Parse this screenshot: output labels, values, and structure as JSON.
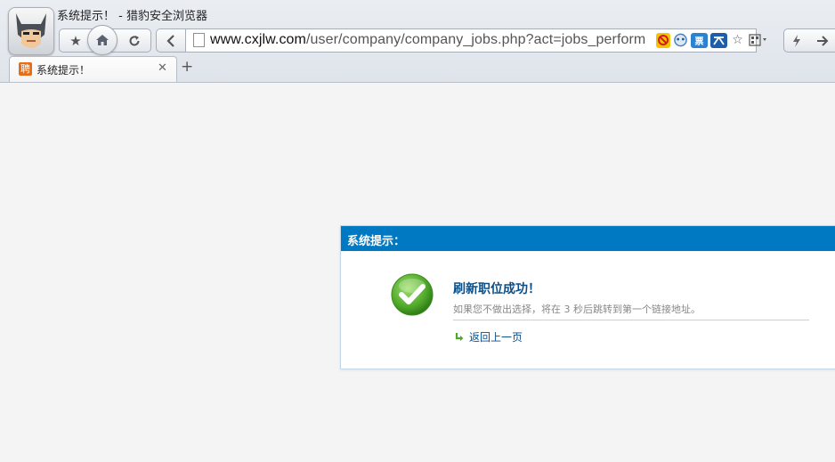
{
  "window": {
    "title": "系统提示！ - 猎豹安全浏览器"
  },
  "toolbar": {
    "bookmark_icon": "star-icon",
    "home_icon": "home-icon",
    "refresh_icon": "refresh-icon",
    "back_icon": "back-arrow-icon",
    "url_host": "www.cxjlw.com",
    "url_path": "/user/company/company_jobs.php?act=jobs_perform",
    "address_icons": [
      "adblock-icon",
      "translate-icon",
      "ticket-icon",
      "reader-icon",
      "favorite-icon",
      "qr-code-icon"
    ],
    "ticket_label": "票",
    "tools": [
      "lightning-icon",
      "forward-arrow-icon"
    ]
  },
  "tabs": [
    {
      "favicon_char": "聘",
      "title": "系统提示！"
    }
  ],
  "dialog": {
    "header": "系统提示：",
    "message_title": "刷新职位成功！",
    "message_sub": "如果您不做出选择，将在 3 秒后跳转到第一个链接地址。",
    "back_link": "返回上一页"
  },
  "colors": {
    "dialog_header": "#0079c2",
    "message_title": "#0b4f8a",
    "success_green": "#5bb030"
  }
}
